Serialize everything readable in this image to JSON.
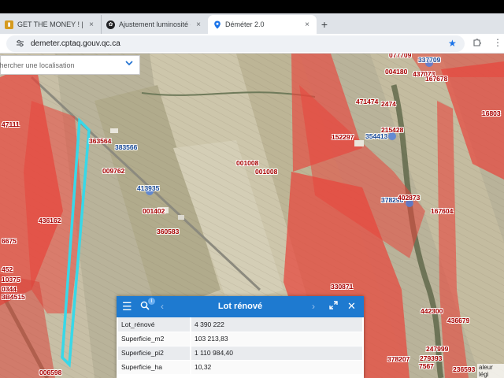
{
  "browser": {
    "tabs": [
      {
        "title": "GET THE MONEY ! | Trello",
        "active": false,
        "favicon": "trello-icon"
      },
      {
        "title": "Ajustement luminosité et taill",
        "active": false,
        "favicon": "chatgpt-icon"
      },
      {
        "title": "Déméter 2.0",
        "active": true,
        "favicon": "location-pin-icon"
      }
    ],
    "close_glyph": "×",
    "new_tab_glyph": "+",
    "url": "demeter.cptaq.gouv.qc.ca"
  },
  "search": {
    "placeholder": "chercher une localisation"
  },
  "map": {
    "lots": [
      {
        "text": "077709",
        "color": "red"
      },
      {
        "text": "337709",
        "color": "blue"
      },
      {
        "text": "004180",
        "color": "red"
      },
      {
        "text": "437073",
        "color": "red"
      },
      {
        "text": "167678",
        "color": "red"
      },
      {
        "text": "471474",
        "color": "red"
      },
      {
        "text": "2474",
        "color": "red"
      },
      {
        "text": "215428",
        "color": "red"
      },
      {
        "text": "354413",
        "color": "blue"
      },
      {
        "text": "152297",
        "color": "red"
      },
      {
        "text": "16803",
        "color": "red"
      },
      {
        "text": "47111",
        "color": "red"
      },
      {
        "text": "363564",
        "color": "red"
      },
      {
        "text": "383566",
        "color": "blue"
      },
      {
        "text": "001008",
        "color": "red"
      },
      {
        "text": "001008",
        "color": "red"
      },
      {
        "text": "009762",
        "color": "red"
      },
      {
        "text": "413935",
        "color": "blue"
      },
      {
        "text": "378296",
        "color": "blue"
      },
      {
        "text": "402873",
        "color": "red"
      },
      {
        "text": "167604",
        "color": "red"
      },
      {
        "text": "001402",
        "color": "red"
      },
      {
        "text": "360583",
        "color": "red"
      },
      {
        "text": "436162",
        "color": "red"
      },
      {
        "text": "6675",
        "color": "red"
      },
      {
        "text": "452",
        "color": "red"
      },
      {
        "text": "10375",
        "color": "red"
      },
      {
        "text": "0344",
        "color": "red"
      },
      {
        "text": "3B4515",
        "color": "red"
      },
      {
        "text": "330871",
        "color": "red"
      },
      {
        "text": "442300",
        "color": "red"
      },
      {
        "text": "436679",
        "color": "red"
      },
      {
        "text": "247999",
        "color": "red"
      },
      {
        "text": "378207",
        "color": "red"
      },
      {
        "text": "279393",
        "color": "red"
      },
      {
        "text": "7567",
        "color": "red"
      },
      {
        "text": "236593",
        "color": "red"
      },
      {
        "text": "006598",
        "color": "red"
      }
    ],
    "legend_label": "aleur légi"
  },
  "panel": {
    "title": "Lot rénové",
    "rows": [
      {
        "key": "Lot_rénové",
        "value": "4 390 222"
      },
      {
        "key": "Superficie_m2",
        "value": "103 213,83"
      },
      {
        "key": "Superficie_pi2",
        "value": "1 110 984,40"
      },
      {
        "key": "Superficie_ha",
        "value": "10,32"
      }
    ]
  },
  "colors": {
    "accent": "#1e7ad0",
    "zone_red": "#e8453c",
    "highlight": "#38d8e8"
  }
}
